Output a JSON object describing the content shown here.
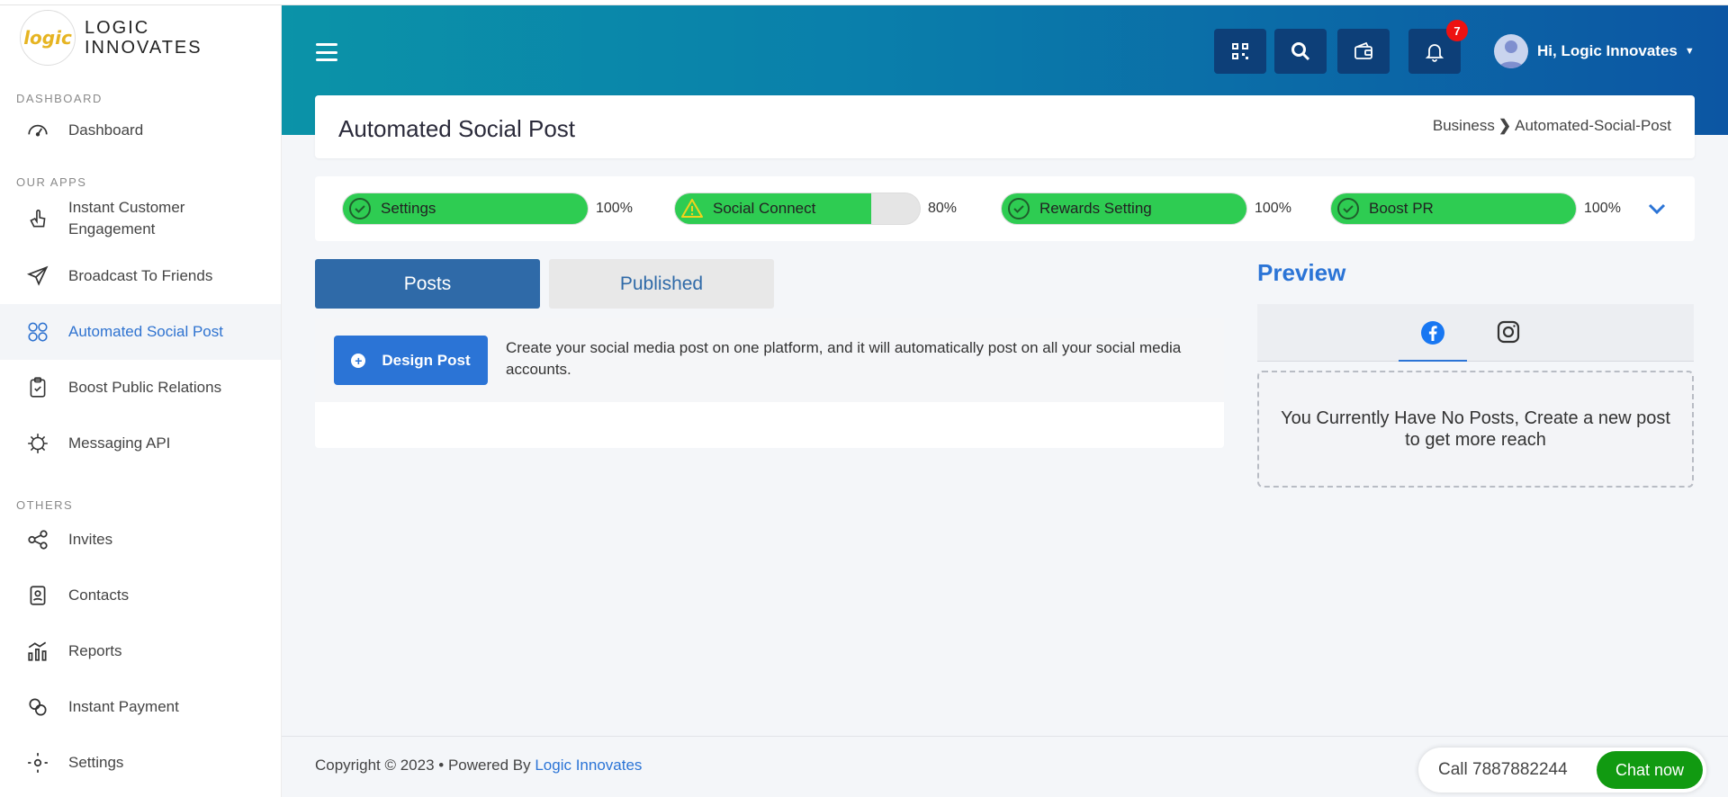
{
  "brand": {
    "logo_mark": "logic",
    "name_line1": "LOGIC",
    "name_line2": "INNOVATES"
  },
  "sidebar": {
    "section_dashboard": "DASHBOARD",
    "section_apps": "OUR APPS",
    "section_others": "OTHERS",
    "items": [
      {
        "label": "Dashboard",
        "icon": "speedometer-icon"
      },
      {
        "label": "Instant Customer Engagement",
        "icon": "hand-icon"
      },
      {
        "label": "Broadcast To Friends",
        "icon": "send-icon"
      },
      {
        "label": "Automated Social Post",
        "icon": "social-icon",
        "active": true
      },
      {
        "label": "Boost Public Relations",
        "icon": "clipboard-icon"
      },
      {
        "label": "Messaging API",
        "icon": "api-icon"
      },
      {
        "label": "Invites",
        "icon": "share-icon"
      },
      {
        "label": "Contacts",
        "icon": "contacts-icon"
      },
      {
        "label": "Reports",
        "icon": "reports-icon"
      },
      {
        "label": "Instant Payment",
        "icon": "payment-icon"
      },
      {
        "label": "Settings",
        "icon": "settings-icon"
      }
    ]
  },
  "header": {
    "notifications_count": "7",
    "user_greeting": "Hi, Logic Innovates",
    "accent": "#0c56a3"
  },
  "page": {
    "title": "Automated Social Post",
    "breadcrumb_root": "Business",
    "breadcrumb_sep": "❯",
    "breadcrumb_current": "Automated-Social-Post"
  },
  "progress": [
    {
      "label": "Settings",
      "pct_text": "100%",
      "value": 1.0,
      "status": "complete"
    },
    {
      "label": "Social Connect",
      "pct_text": "80%",
      "value": 0.8,
      "status": "warning"
    },
    {
      "label": "Rewards Setting",
      "pct_text": "100%",
      "value": 1.0,
      "status": "complete"
    },
    {
      "label": "Boost PR",
      "pct_text": "100%",
      "value": 1.0,
      "status": "complete"
    }
  ],
  "tabs": {
    "posts": "Posts",
    "published": "Published"
  },
  "posts_panel": {
    "design_button": "Design Post",
    "description": "Create your social media post on one platform, and it will automatically post on all your social media accounts."
  },
  "preview": {
    "title": "Preview",
    "empty_message": "You Currently Have No Posts, Create a new post to get more reach"
  },
  "footer": {
    "copyright": "Copyright © 2023  • Powered By ",
    "powered_link": "Logic Innovates",
    "call_text": "Call 7887882244",
    "chat_button": "Chat now"
  },
  "colors": {
    "primary": "#2b74d6",
    "progress_green": "#2ecc52",
    "chat_green": "#119a11"
  }
}
